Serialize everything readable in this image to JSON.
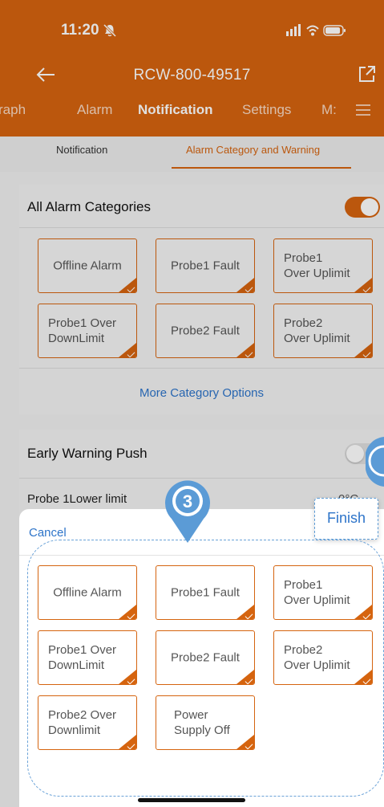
{
  "status_bar": {
    "time": "11:20"
  },
  "header": {
    "title": "RCW-800-49517",
    "tabs": [
      {
        "label": "raph"
      },
      {
        "label": "Alarm"
      },
      {
        "label": "Notification"
      },
      {
        "label": "Settings"
      },
      {
        "label": "M:"
      }
    ]
  },
  "subtabs": [
    {
      "label": "Notification"
    },
    {
      "label": "Alarm Category and Warning"
    }
  ],
  "all_alarm_categories": {
    "title": "All Alarm Categories",
    "toggle_on": true,
    "chips": [
      {
        "label": "Offline Alarm",
        "selected": true
      },
      {
        "label": "Probe1 Fault",
        "selected": true
      },
      {
        "label": "Probe1\nOver Uplimit",
        "selected": true
      },
      {
        "label": "Probe1 Over\nDownLimit",
        "selected": true
      },
      {
        "label": "Probe2 Fault",
        "selected": true
      },
      {
        "label": "Probe2\nOver Uplimit",
        "selected": true
      }
    ],
    "more_link": "More Category Options"
  },
  "early_warning": {
    "title": "Early Warning Push",
    "toggle_on": false,
    "probe_row_label": "Probe 1Lower limit",
    "probe_row_value": "0°C"
  },
  "sheet": {
    "cancel_label": "Cancel",
    "finish_label": "Finish",
    "step_number": "3",
    "chips": [
      {
        "label": "Offline Alarm",
        "selected": true
      },
      {
        "label": "Probe1 Fault",
        "selected": true
      },
      {
        "label": "Probe1\nOver Uplimit",
        "selected": true
      },
      {
        "label": "Probe1 Over\nDownLimit",
        "selected": true
      },
      {
        "label": "Probe2 Fault",
        "selected": true
      },
      {
        "label": "Probe2\nOver Uplimit",
        "selected": true
      },
      {
        "label": "Probe2 Over\nDownlimit",
        "selected": true
      },
      {
        "label": "Power\nSupply Off",
        "selected": true
      }
    ]
  },
  "colors": {
    "accent": "#d5640f",
    "link": "#2d74c9",
    "marker": "#5b9bd6"
  },
  "icons": [
    "back-arrow-icon",
    "share-icon",
    "menu-icon",
    "bell-muted-icon",
    "signal-icon",
    "wifi-icon",
    "battery-icon",
    "location-pin-icon",
    "checkmark-icon"
  ]
}
